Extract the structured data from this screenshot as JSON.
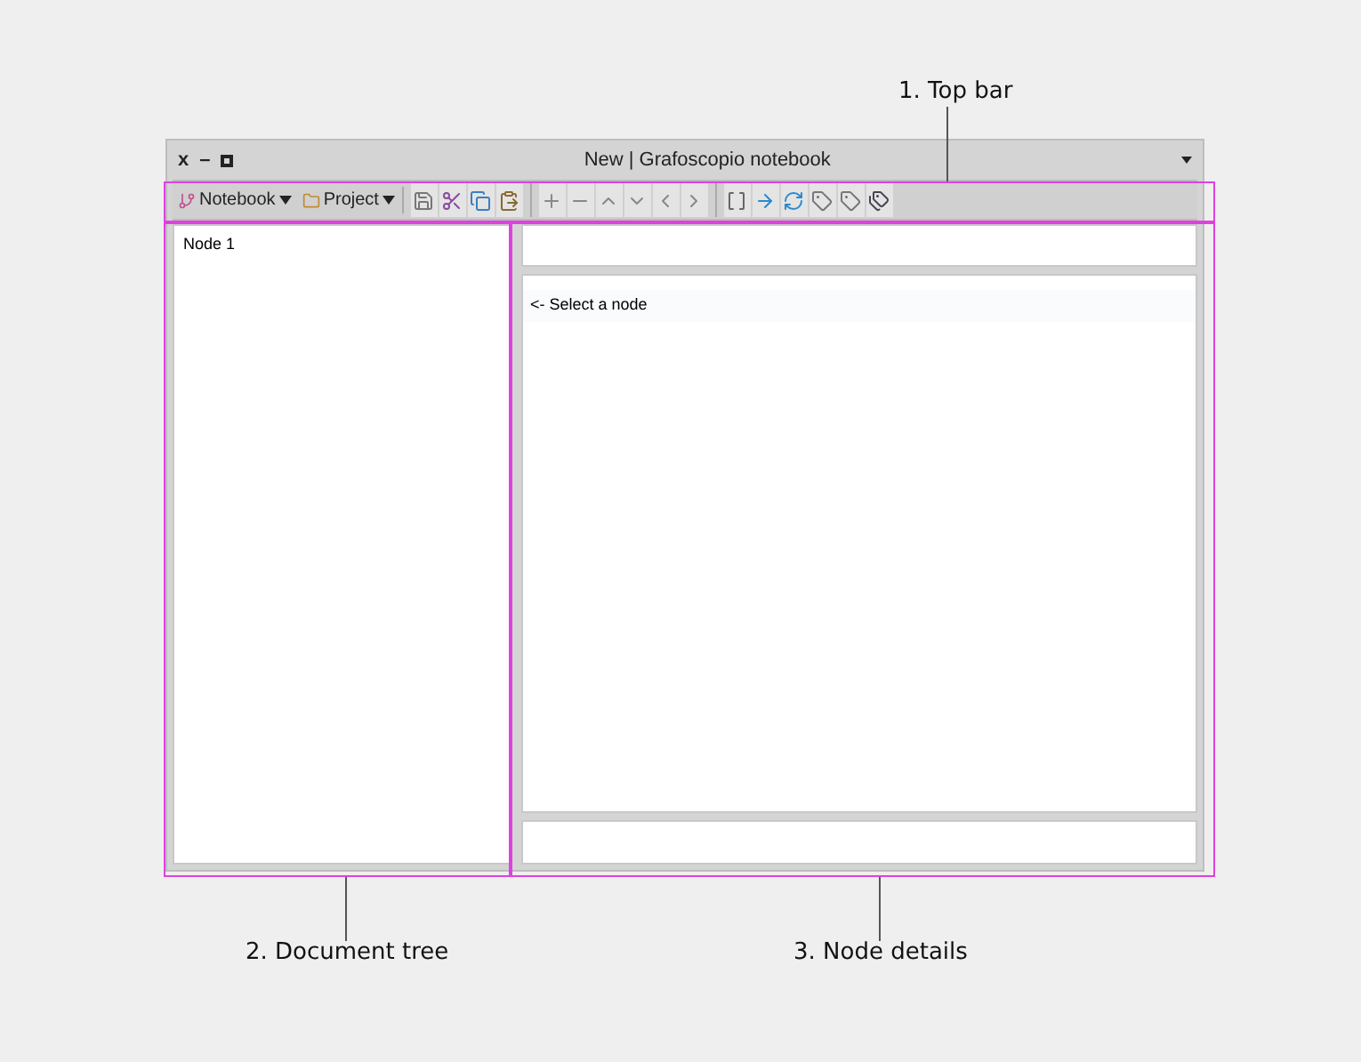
{
  "window": {
    "title": "New | Grafoscopio notebook",
    "close": "x",
    "minimize": "–"
  },
  "toolbar": {
    "menus": [
      {
        "label": "Notebook",
        "kind": "notebook"
      },
      {
        "label": "Project",
        "kind": "project"
      }
    ]
  },
  "tree": {
    "nodes": [
      {
        "label": "Node 1",
        "selected": false
      }
    ]
  },
  "details": {
    "message": "<- Select a node"
  },
  "annotations": [
    {
      "label": "1. Top bar",
      "kind": "top"
    },
    {
      "label": "2. Document tree",
      "kind": "tree"
    },
    {
      "label": "3. Node details",
      "kind": "details"
    }
  ]
}
